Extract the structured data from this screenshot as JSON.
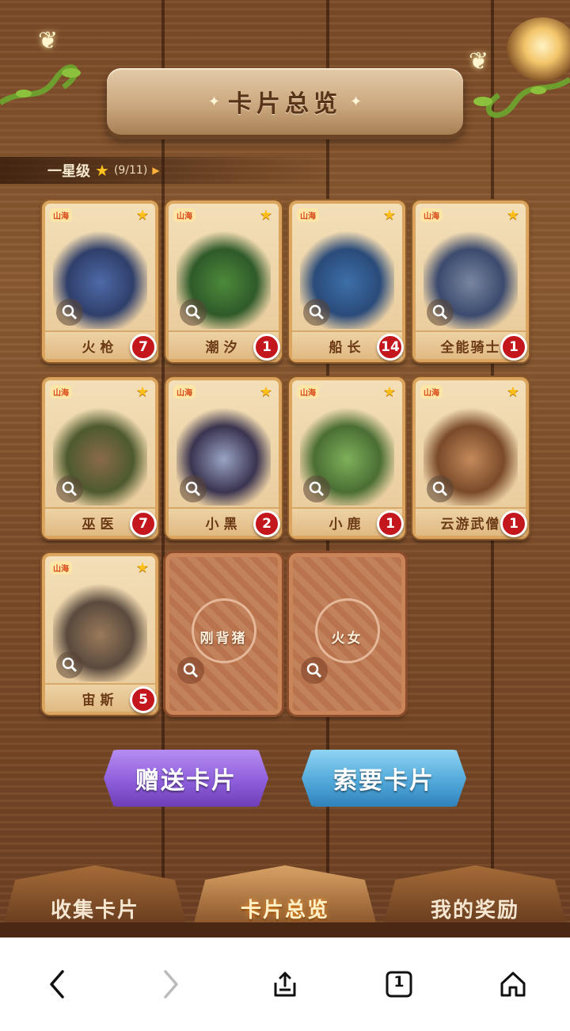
{
  "header": {
    "title": "卡片总览"
  },
  "section": {
    "label": "一星级",
    "count": "(9/11)"
  },
  "cards": [
    {
      "name": "火枪",
      "count": "7",
      "logo": "山海"
    },
    {
      "name": "潮汐",
      "count": "1",
      "logo": "山海"
    },
    {
      "name": "船长",
      "count": "14",
      "logo": "山海"
    },
    {
      "name": "全能骑士",
      "count": "1",
      "logo": "山海"
    },
    {
      "name": "巫医",
      "count": "7",
      "logo": "山海"
    },
    {
      "name": "小黑",
      "count": "2",
      "logo": "山海"
    },
    {
      "name": "小鹿",
      "count": "1",
      "logo": "山海"
    },
    {
      "name": "云游武僧",
      "count": "1",
      "logo": "山海"
    },
    {
      "name": "宙斯",
      "count": "5",
      "logo": "山海"
    }
  ],
  "locked_cards": [
    {
      "name": "刚背猪"
    },
    {
      "name": "火女"
    }
  ],
  "buttons": {
    "gift": "赠送卡片",
    "ask": "索要卡片"
  },
  "tabs": [
    "收集卡片",
    "卡片总览",
    "我的奖励"
  ],
  "browser": {
    "tabs_count": "1"
  },
  "colors": {
    "badge": "#c4161d",
    "star": "#ffc21f",
    "gift_button": "#8e5fdb",
    "ask_button": "#52a9da"
  }
}
